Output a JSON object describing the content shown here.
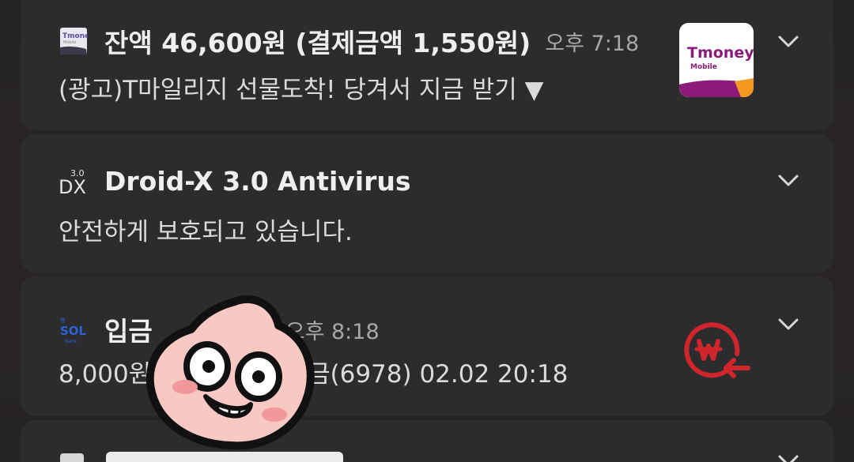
{
  "notifications": [
    {
      "app_icon": "tmoney-icon",
      "title": "잔액 46,600원 (결제금액 1,550원)",
      "time": "오후 7:18",
      "text": "(광고)T마일리지 선물도착! 당겨서 지금 받기 ▼",
      "thumbnail": {
        "brand": "Tmoney",
        "sub": "Mobile",
        "accent": "#8b1a7a"
      }
    },
    {
      "app_icon": "droid-x-icon",
      "title": "Droid-X 3.0 Antivirus",
      "icon_badge": "3.0",
      "icon_letters": "DX",
      "text": "안전하게 보호되고 있습니다."
    },
    {
      "app_icon": "sol-bank-icon",
      "icon_letters": "SOL",
      "title": "입금",
      "time": "오후 8:18",
      "text_start": "8,000원",
      "text_end": "금(6978) 02.02 20:18",
      "thumbnail_icon": "won-refund-icon",
      "accent": "#d0262b"
    },
    {
      "app_icon": "generic-app-icon"
    }
  ],
  "sticker": {
    "name": "apeach-sticker-icon"
  }
}
